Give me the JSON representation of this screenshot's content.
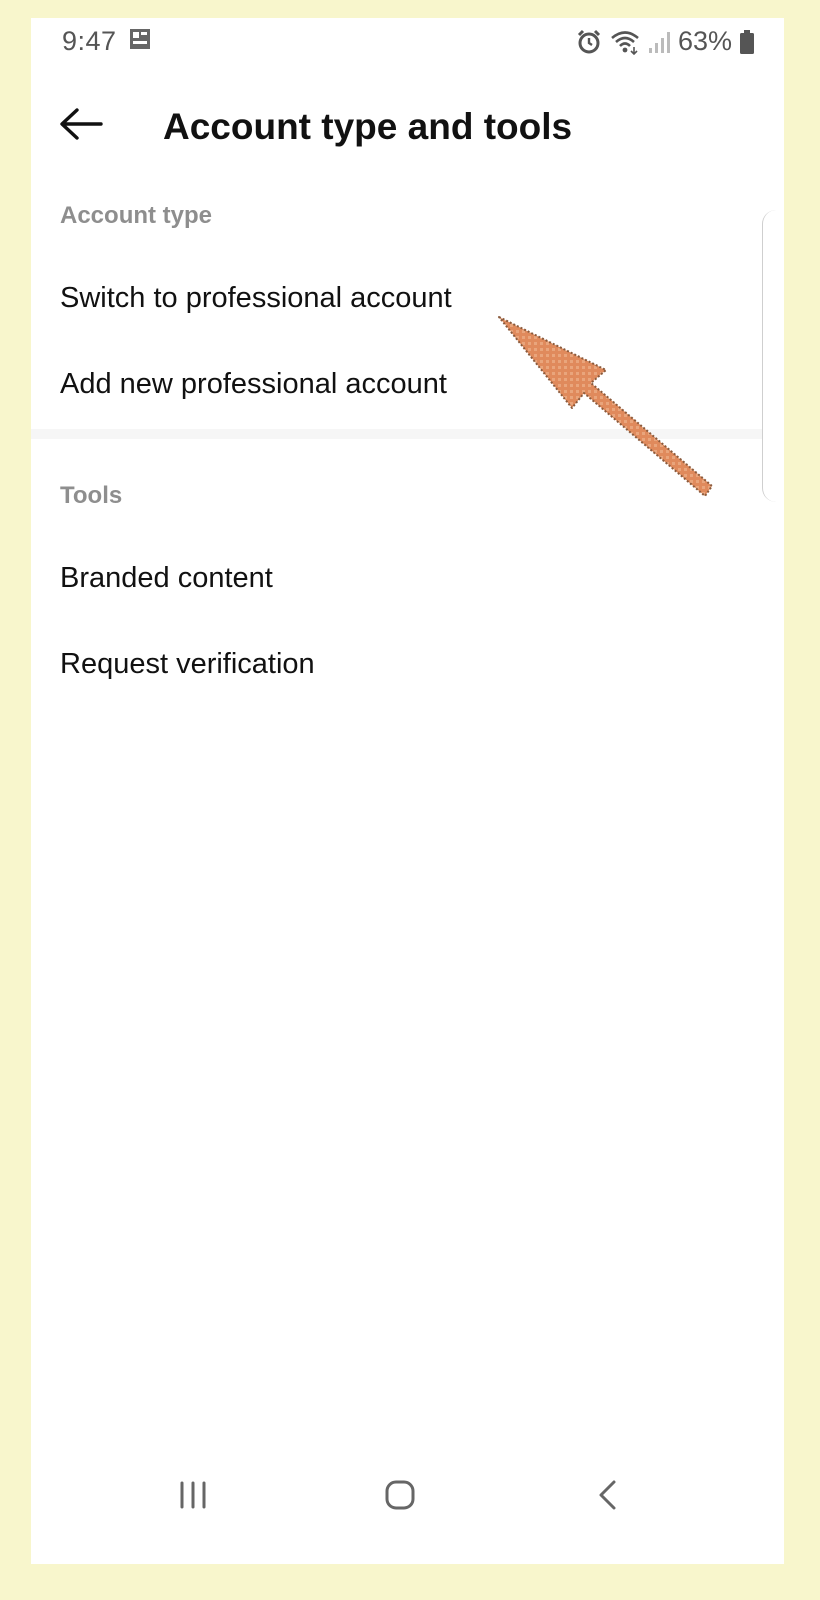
{
  "status_bar": {
    "time": "9:47",
    "battery": "63%",
    "icons": [
      "notification-icon",
      "alarm-icon",
      "wifi-icon",
      "signal-icon",
      "battery-icon"
    ]
  },
  "header": {
    "back_icon": "back-arrow-icon",
    "title": "Account type and tools"
  },
  "sections": {
    "account_type": {
      "label": "Account type",
      "items": [
        {
          "label": "Switch to professional account"
        },
        {
          "label": "Add new professional account"
        }
      ]
    },
    "tools": {
      "label": "Tools",
      "items": [
        {
          "label": "Branded content"
        },
        {
          "label": "Request verification"
        }
      ]
    }
  },
  "nav_bar": {
    "icons": [
      "recent-apps-icon",
      "home-icon",
      "back-icon"
    ]
  },
  "annotation": {
    "icon": "pointer-arrow-icon",
    "color": "#e08a5c",
    "target": "Switch to professional account"
  },
  "colors": {
    "background": "#f8f6cc",
    "screen": "#ffffff",
    "section_header": "#8e8e8e",
    "text": "#111111"
  }
}
